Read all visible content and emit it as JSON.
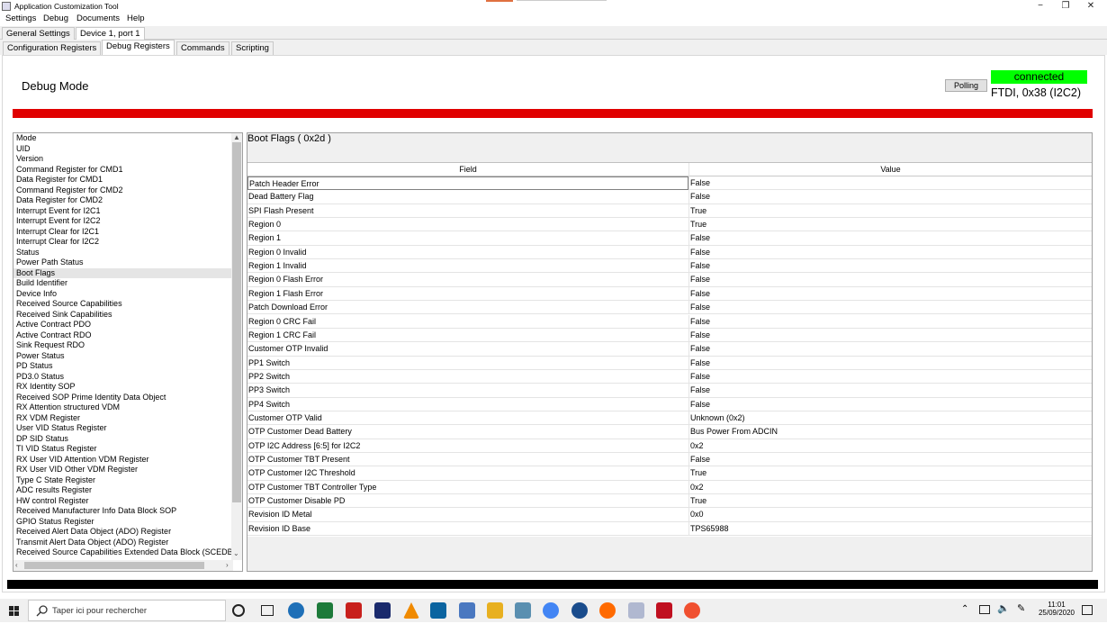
{
  "window": {
    "title": "Application Customization Tool",
    "min_glyph": "−",
    "max_glyph": "❐",
    "close_glyph": "✕"
  },
  "menu": [
    "Settings",
    "Debug",
    "Documents",
    "Help"
  ],
  "outer_tabs": [
    "General Settings",
    "Device 1, port 1"
  ],
  "inner_tabs": [
    "Configuration Registers",
    "Debug Registers",
    "Commands",
    "Scripting"
  ],
  "header": {
    "mode_title": "Debug Mode",
    "polling_label": "Polling",
    "status": "connected",
    "status_color": "#00ff00",
    "connection": "FTDI, 0x38 (I2C2)",
    "error_bar_color": "#e00000"
  },
  "registers": [
    "Mode",
    "UID",
    "Version",
    "Command Register for CMD1",
    "Data Register for CMD1",
    "Command Register for CMD2",
    "Data Register for CMD2",
    "Interrupt Event for I2C1",
    "Interrupt Event for I2C2",
    "Interrupt Clear for I2C1",
    "Interrupt Clear for I2C2",
    "Status",
    "Power Path Status",
    "Boot Flags",
    "Build Identifier",
    "Device Info",
    "Received Source Capabilities",
    "Received Sink Capabilities",
    "Active Contract PDO",
    "Active Contract RDO",
    "Sink Request RDO",
    "Power Status",
    "PD Status",
    "PD3.0 Status",
    "RX Identity SOP",
    "Received SOP Prime Identity Data Object",
    "RX Attention structured VDM",
    "RX VDM Register",
    "User VID Status Register",
    "DP SID Status",
    "TI VID Status Register",
    "RX User VID Attention VDM Register",
    "RX User VID Other VDM Register",
    "Type C State Register",
    "ADC results Register",
    "HW control Register",
    "Received Manufacturer Info Data Block SOP",
    "GPIO Status Register",
    "Received Alert Data Object (ADO) Register",
    "Transmit Alert Data Object (ADO) Register",
    "Received Source Capabilities Extended Data Block (SCEDB"
  ],
  "selected_register": "Boot Flags",
  "scroll": {
    "up": "▲",
    "down": "⌄",
    "left": "‹",
    "right": "›"
  },
  "detail": {
    "title": "Boot Flags  ( 0x2d )",
    "columns": [
      "Field",
      "Value"
    ],
    "rows": [
      [
        "Patch Header Error",
        "False"
      ],
      [
        "Dead Battery Flag",
        "False"
      ],
      [
        "SPI Flash Present",
        "True"
      ],
      [
        "Region 0",
        "True"
      ],
      [
        "Region 1",
        "False"
      ],
      [
        "Region 0 Invalid",
        "False"
      ],
      [
        "Region 1 Invalid",
        "False"
      ],
      [
        "Region 0 Flash Error",
        "False"
      ],
      [
        "Region 1 Flash Error",
        "False"
      ],
      [
        "Patch Download Error",
        "False"
      ],
      [
        "Region 0 CRC Fail",
        "False"
      ],
      [
        "Region 1 CRC Fail",
        "False"
      ],
      [
        "Customer OTP Invalid",
        "False"
      ],
      [
        "PP1 Switch",
        "False"
      ],
      [
        "PP2 Switch",
        "False"
      ],
      [
        "PP3 Switch",
        "False"
      ],
      [
        "PP4 Switch",
        "False"
      ],
      [
        "Customer OTP Valid",
        "Unknown (0x2)"
      ],
      [
        "OTP Customer Dead Battery",
        "Bus Power From ADCIN"
      ],
      [
        "OTP I2C Address [6:5] for I2C2",
        "0x2"
      ],
      [
        "OTP Customer TBT Present",
        "False"
      ],
      [
        "OTP Customer I2C Threshold",
        "True"
      ],
      [
        "OTP Customer TBT Controller Type",
        "0x2"
      ],
      [
        "OTP Customer Disable PD",
        "True"
      ],
      [
        "Revision ID Metal",
        "0x0"
      ],
      [
        "Revision ID Base",
        "TPS65988"
      ]
    ]
  },
  "taskbar": {
    "search_placeholder": "Taper ici pour rechercher",
    "time": "11:01",
    "date": "25/09/2020"
  }
}
